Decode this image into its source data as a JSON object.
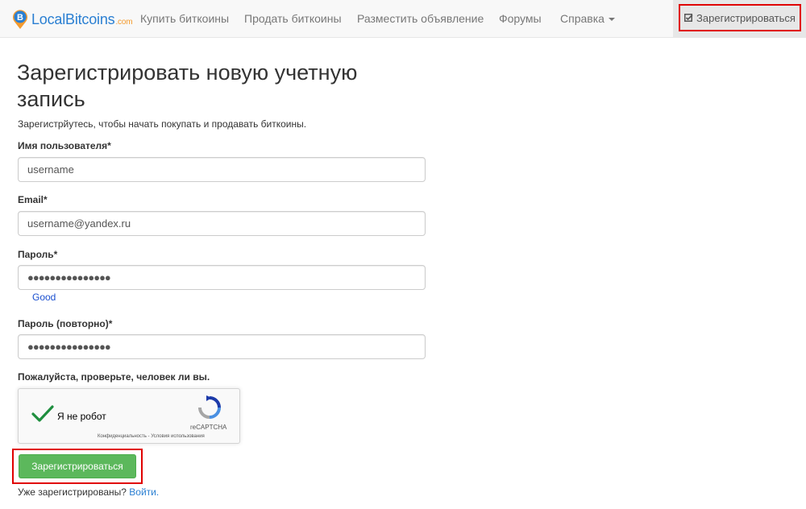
{
  "navbar": {
    "brand_name": "LocalBitcoins",
    "brand_suffix": ".com",
    "links": [
      {
        "label": "Купить биткоины"
      },
      {
        "label": "Продать биткоины"
      },
      {
        "label": "Разместить объявление"
      },
      {
        "label": "Форумы"
      },
      {
        "label": "Справка"
      }
    ],
    "register_label": "Зарегистрироваться"
  },
  "form": {
    "title": "Зарегистрировать новую учетную запись",
    "subtitle": "Зарегистрйутесь, чтобы начать покупать и продавать биткоины.",
    "username": {
      "label": "Имя пользователя*",
      "value": "username"
    },
    "email": {
      "label": "Email*",
      "value": "username@yandex.ru"
    },
    "password": {
      "label": "Пароль*",
      "value": "●●●●●●●●●●●●●●●",
      "strength": "Good"
    },
    "password2": {
      "label": "Пароль (повторно)*",
      "value": "●●●●●●●●●●●●●●●"
    },
    "captcha_prompt": "Пожалуйста, проверьте, человек ли вы.",
    "submit_label": "Зарегистрироваться",
    "footer_text": "Уже зарегистрированы?",
    "login_link": "Войти."
  },
  "recaptcha": {
    "label": "Я не робот",
    "brand": "reCAPTCHA",
    "links": "Конфиденциальность - Условия использования",
    "checked": true,
    "check_color": "#1e8e3e"
  },
  "colors": {
    "brand_blue": "#2a7fd2",
    "brand_orange": "#f49a2d",
    "success_green": "#5cb85c",
    "highlight_red": "#e00000"
  }
}
